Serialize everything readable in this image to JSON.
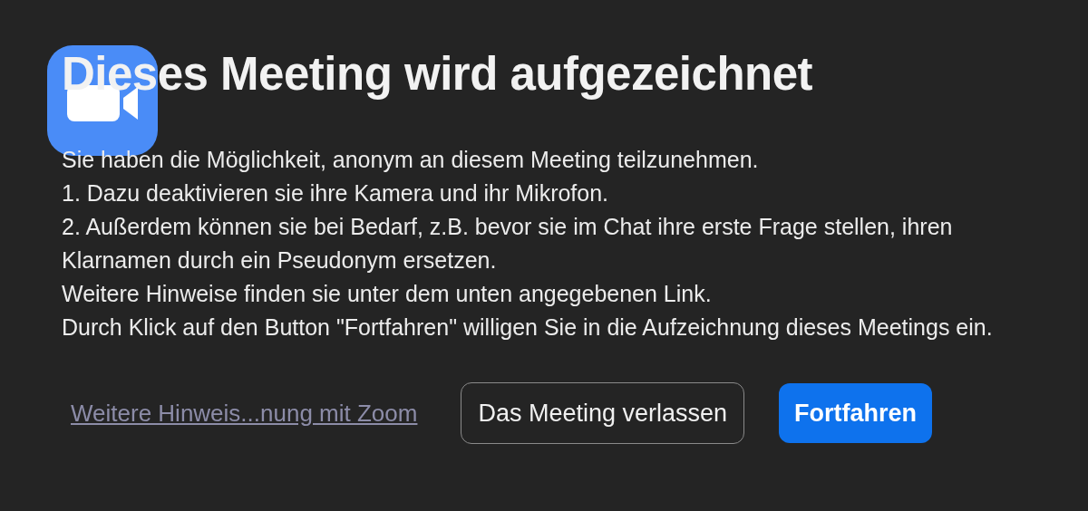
{
  "title": "Dieses Meeting wird aufgezeichnet",
  "message_lines": [
    "Sie haben die Möglichkeit, anonym an diesem Meeting teilzunehmen.",
    "1. Dazu deaktivieren sie ihre Kamera und ihr Mikrofon.",
    "2. Außerdem können sie bei Bedarf, z.B. bevor sie im Chat ihre erste Frage stellen, ihren Klarnamen durch ein Pseudonym ersetzen.",
    "Weitere Hinweise finden sie unter dem unten angegebenen Link.",
    "Durch Klick auf den Button \"Fortfahren\" willigen Sie in die Aufzeichnung dieses Meetings ein."
  ],
  "link": "Weitere Hinweis...nung mit Zoom",
  "buttons": [
    {
      "label": "Das Meeting verlassen",
      "kind": "secondary"
    },
    {
      "label": "Fortfahren",
      "kind": "primary"
    }
  ]
}
